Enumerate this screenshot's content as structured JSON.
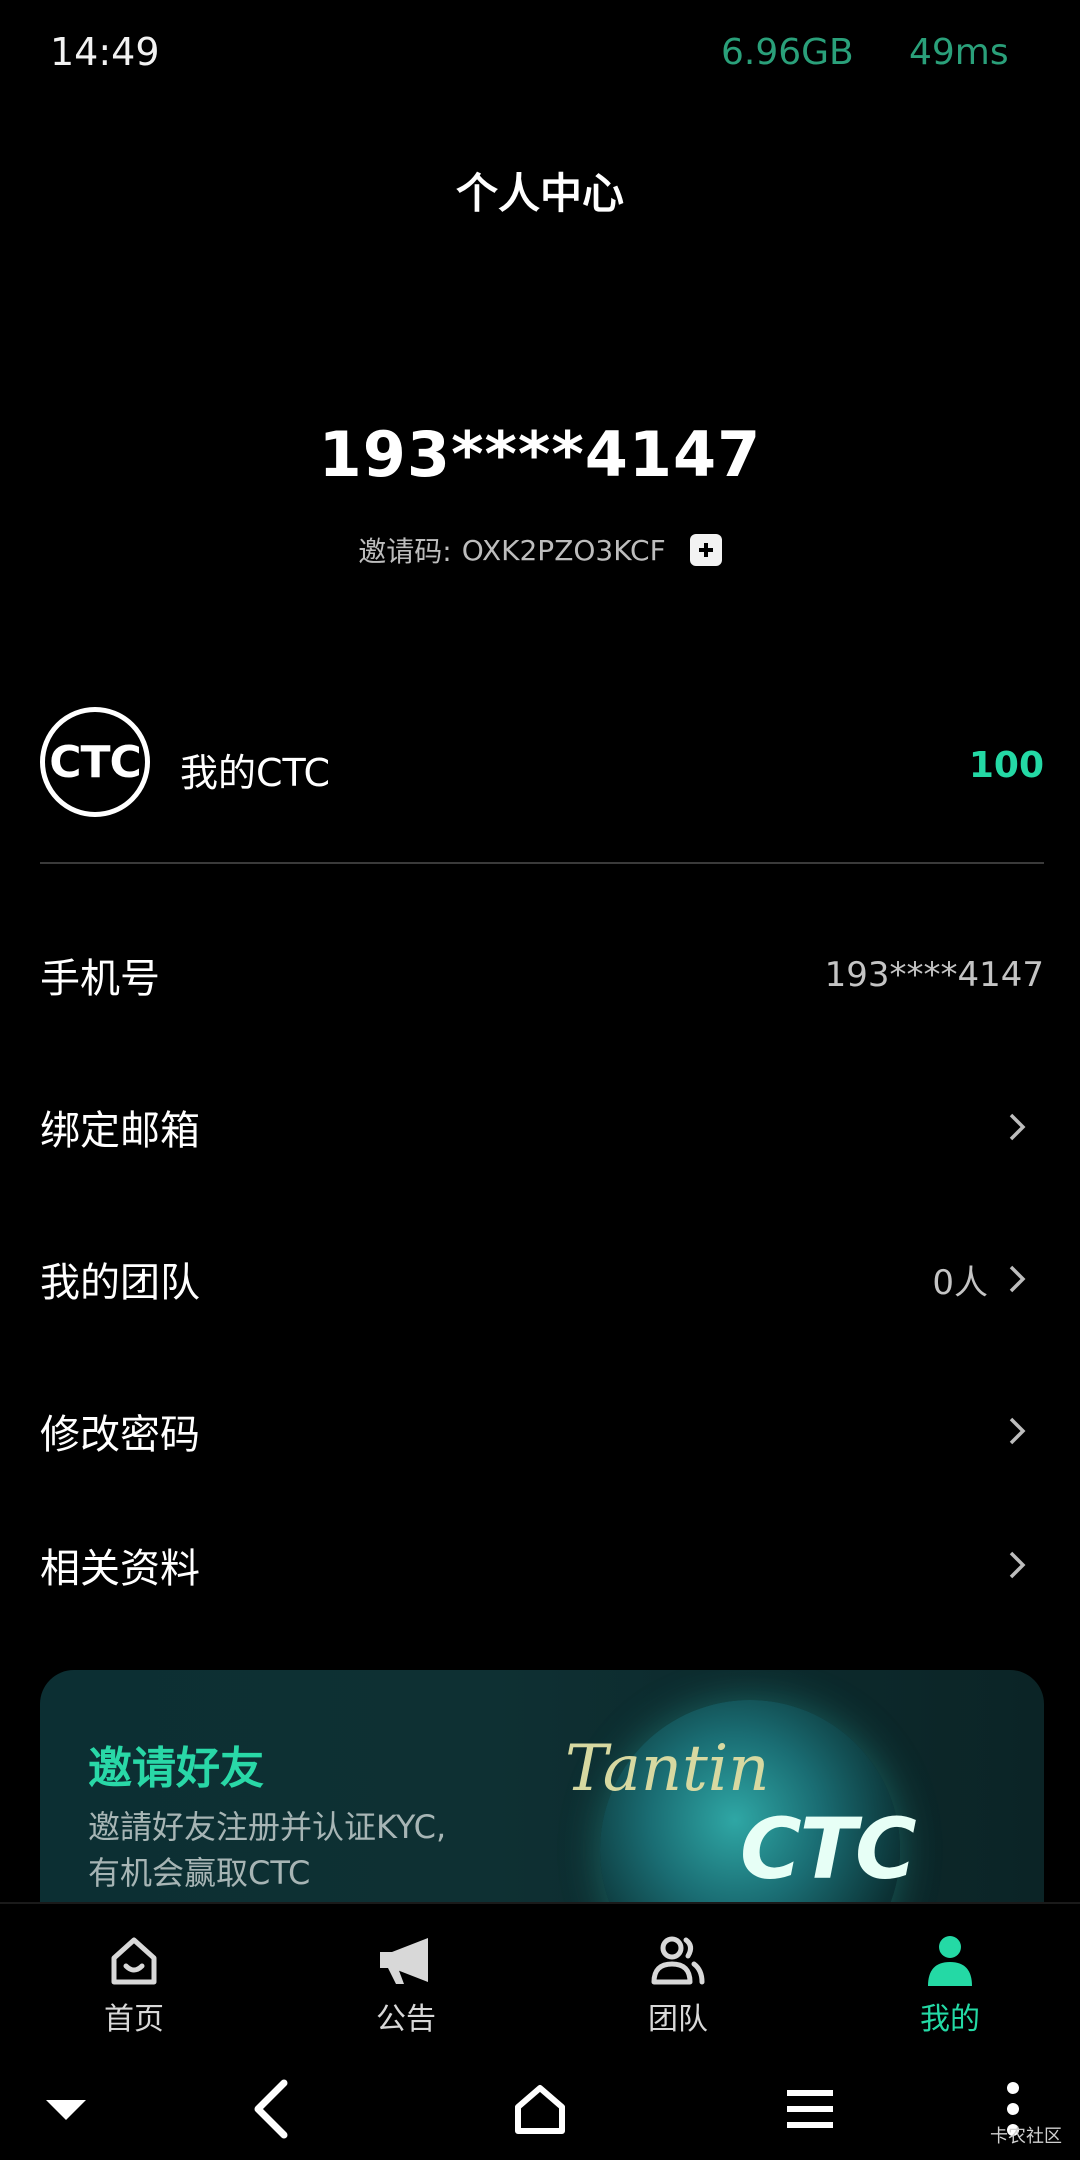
{
  "status_bar": {
    "time": "14:49",
    "memory": "6.96GB",
    "ping": "49ms"
  },
  "page": {
    "title": "个人中心"
  },
  "profile": {
    "phone": "193****4147",
    "invite_label": "邀请码:",
    "invite_code": "OXK2PZO3KCF"
  },
  "ctc": {
    "logo_text": "CTC",
    "label": "我的CTC",
    "value": "100"
  },
  "menu": [
    {
      "label": "手机号",
      "value": "193****4147",
      "chevron": false
    },
    {
      "label": "绑定邮箱",
      "value": "",
      "chevron": true
    },
    {
      "label": "我的团队",
      "value": "0人",
      "chevron": true
    },
    {
      "label": "修改密码",
      "value": "",
      "chevron": true
    },
    {
      "label": "相关资料",
      "value": "",
      "chevron": true
    }
  ],
  "banner": {
    "title": "邀请好友",
    "desc_line1": "邀請好友注册并认证KYC,",
    "desc_line2": "有机会赢取CTC",
    "brand_text": "Tantin",
    "brand_ctc": "CTC"
  },
  "bottom_nav": [
    {
      "label": "首页",
      "icon": "home-icon",
      "active": false
    },
    {
      "label": "公告",
      "icon": "megaphone-icon",
      "active": false
    },
    {
      "label": "团队",
      "icon": "team-icon",
      "active": false
    },
    {
      "label": "我的",
      "icon": "profile-icon",
      "active": true
    }
  ],
  "watermark": "卡农社区",
  "colors": {
    "accent": "#24d9a5",
    "status_text": "#2aa07a",
    "background": "#000000"
  }
}
